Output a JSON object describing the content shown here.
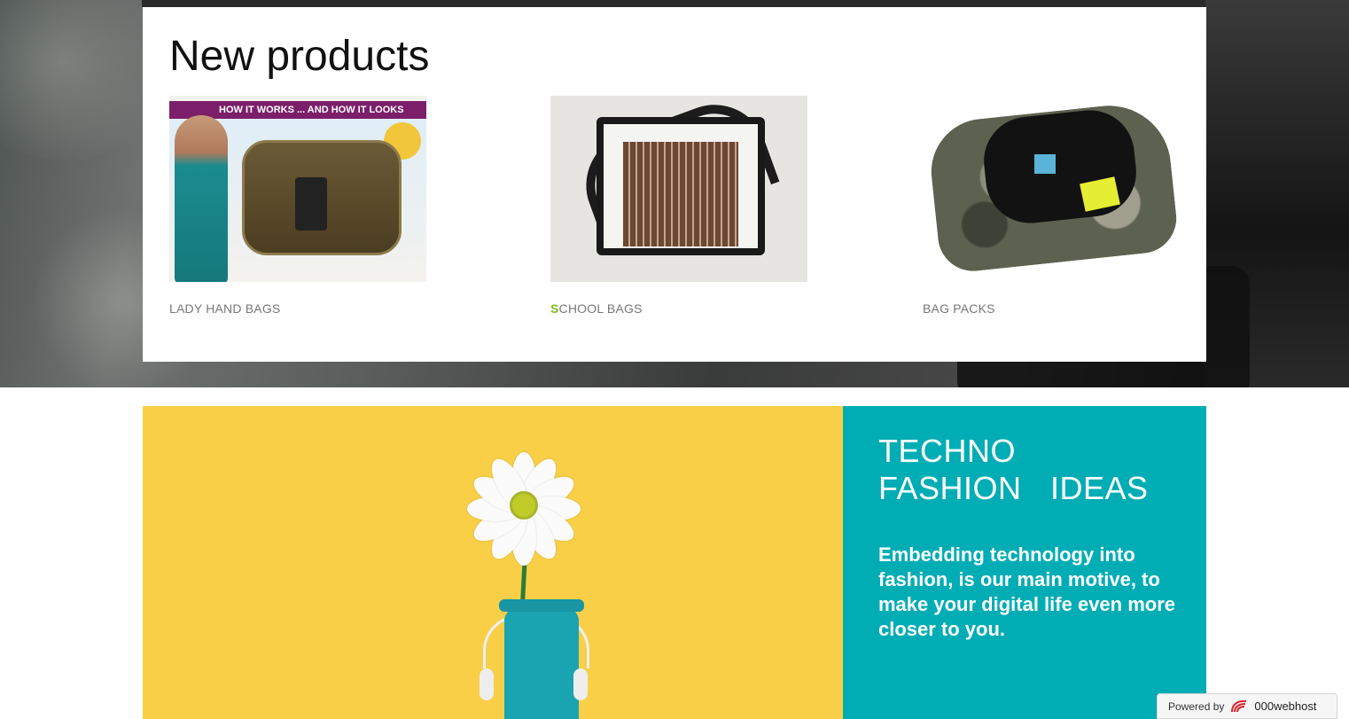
{
  "products": {
    "title": "New products",
    "items": [
      {
        "label": "LADY HAND BAGS",
        "image_text": "HOW IT WORKS ... AND HOW IT LOOKS"
      },
      {
        "label_first": "S",
        "label_rest": "CHOOL BAGS"
      },
      {
        "label": "BAG PACKS"
      }
    ]
  },
  "feature": {
    "title": "TECHNO FASHION IDEAS",
    "body": "Embedding technology into fashion, is our main motive, to make your digital life even more closer to you."
  },
  "badge": {
    "prefix": "Powered by",
    "brand": "000webhost"
  },
  "colors": {
    "accent_teal": "#00adb5",
    "feature_yellow": "#f8cf47",
    "caption_green": "#7fbf1f"
  }
}
